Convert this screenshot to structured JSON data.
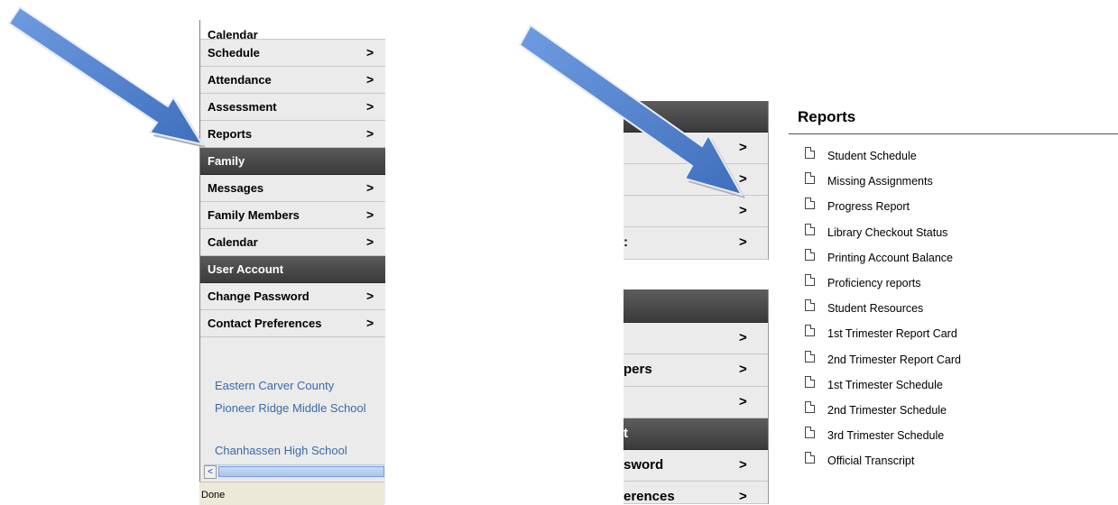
{
  "left_nav": {
    "items": [
      {
        "label": "Calendar",
        "kind": "plain"
      },
      {
        "label": "Schedule",
        "chevron": ">"
      },
      {
        "label": "Attendance",
        "chevron": ">"
      },
      {
        "label": "Assessment",
        "chevron": ">"
      },
      {
        "label": "Reports",
        "chevron": ">"
      },
      {
        "label": "Family",
        "kind": "header"
      },
      {
        "label": "Messages",
        "chevron": ">"
      },
      {
        "label": "Family Members",
        "chevron": ">"
      },
      {
        "label": "Calendar",
        "chevron": ">"
      },
      {
        "label": "User Account",
        "kind": "header"
      },
      {
        "label": "Change Password",
        "chevron": ">"
      },
      {
        "label": "Contact Preferences",
        "chevron": ">"
      }
    ],
    "links": [
      "Eastern Carver County",
      "Pioneer Ridge Middle School",
      "Chanhassen High School"
    ],
    "scroll_left": "<"
  },
  "status_bar": {
    "text": "Done"
  },
  "middle_panel": {
    "top_rows": [
      {
        "label": "",
        "chevron": ">"
      },
      {
        "label": "",
        "chevron": ">"
      },
      {
        "label": "",
        "chevron": ">"
      },
      {
        "label": ":",
        "chevron": ">"
      }
    ],
    "bottom_rows": [
      {
        "label": "",
        "chevron": ">"
      },
      {
        "label": "pers",
        "chevron": ">"
      },
      {
        "label": "",
        "chevron": ">"
      },
      {
        "label": "t",
        "kind": "header"
      },
      {
        "label": "sword",
        "chevron": ">"
      },
      {
        "label": "erences",
        "chevron": ">"
      }
    ]
  },
  "reports": {
    "title": "Reports",
    "items": [
      "Student Schedule",
      "Missing Assignments",
      "Progress Report",
      "Library Checkout Status",
      "Printing Account Balance",
      "Proficiency reports",
      "Student Resources",
      "1st Trimester Report Card",
      "2nd Trimester Report Card",
      "1st Trimester Schedule",
      "2nd Trimester Schedule",
      "3rd Trimester Schedule",
      "Official Transcript"
    ]
  },
  "colors": {
    "arrow": "#4f7fc9",
    "header_bg": "#444444",
    "link": "#3b6aa6"
  }
}
